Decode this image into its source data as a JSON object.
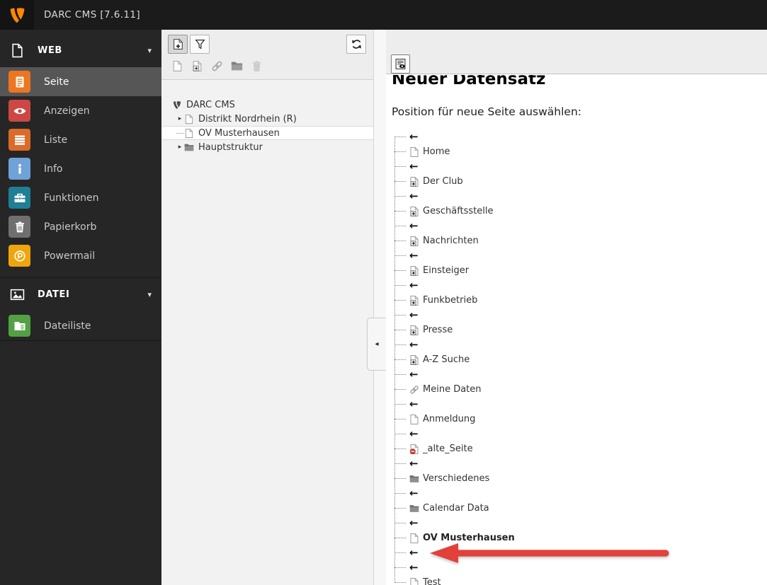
{
  "topbar": {
    "title": "DARC CMS [7.6.11]",
    "logo_icon": "typo3-logo-icon"
  },
  "colors": {
    "typo3_orange": "#ff8700",
    "annotation_arrow": "#e2403a"
  },
  "sidebar": {
    "sections": [
      {
        "label": "WEB",
        "icon": "web-section-icon",
        "chevron_icon": "chevron-down-icon",
        "items": [
          {
            "label": "Seite",
            "icon": "page-module-icon",
            "color": "#ed7621",
            "selected": true
          },
          {
            "label": "Anzeigen",
            "icon": "view-module-icon",
            "color": "#cd4744"
          },
          {
            "label": "Liste",
            "icon": "list-module-icon",
            "color": "#da6b28"
          },
          {
            "label": "Info",
            "icon": "info-module-icon",
            "color": "#6fa2d8"
          },
          {
            "label": "Funktionen",
            "icon": "functions-module-icon",
            "color": "#1e7f95"
          },
          {
            "label": "Papierkorb",
            "icon": "recycler-module-icon",
            "color": "#6f6f6f"
          },
          {
            "label": "Powermail",
            "icon": "powermail-module-icon",
            "color": "#efa50c"
          }
        ]
      },
      {
        "label": "DATEI",
        "icon": "datei-section-icon",
        "chevron_icon": "chevron-down-icon",
        "items": [
          {
            "label": "Dateiliste",
            "icon": "filelist-module-icon",
            "color": "#54a044"
          }
        ]
      }
    ]
  },
  "tree": {
    "nodes": [
      {
        "label": "DARC CMS",
        "icon": "typo3-root-icon",
        "level": 0
      },
      {
        "label": "Distrikt Nordrhein (R)",
        "icon": "page-icon",
        "level": 1,
        "expandable": true
      },
      {
        "label": "OV Musterhausen",
        "icon": "page-icon",
        "level": 1,
        "selected": true,
        "connector": true
      },
      {
        "label": "Hauptstruktur",
        "icon": "folder-icon",
        "level": 1,
        "expandable": true
      }
    ]
  },
  "main": {
    "heading": "Neuer Datensatz",
    "subheading": "Position für neue Seite auswählen:",
    "position_list": [
      {
        "type": "arrow"
      },
      {
        "type": "page",
        "label": "Home",
        "icon": "page-icon"
      },
      {
        "type": "arrow"
      },
      {
        "type": "page",
        "label": "Der Club",
        "icon": "shortcut-page-icon"
      },
      {
        "type": "arrow"
      },
      {
        "type": "page",
        "label": "Geschäftsstelle",
        "icon": "shortcut-page-icon"
      },
      {
        "type": "arrow"
      },
      {
        "type": "page",
        "label": "Nachrichten",
        "icon": "shortcut-page-icon"
      },
      {
        "type": "arrow"
      },
      {
        "type": "page",
        "label": "Einsteiger",
        "icon": "shortcut-page-icon"
      },
      {
        "type": "arrow"
      },
      {
        "type": "page",
        "label": "Funkbetrieb",
        "icon": "shortcut-page-icon"
      },
      {
        "type": "arrow"
      },
      {
        "type": "page",
        "label": "Presse",
        "icon": "shortcut-page-icon"
      },
      {
        "type": "arrow"
      },
      {
        "type": "page",
        "label": "A-Z Suche",
        "icon": "shortcut-page-icon"
      },
      {
        "type": "arrow"
      },
      {
        "type": "page",
        "label": "Meine Daten",
        "icon": "link-icon"
      },
      {
        "type": "arrow"
      },
      {
        "type": "page",
        "label": "Anmeldung",
        "icon": "page-icon"
      },
      {
        "type": "arrow"
      },
      {
        "type": "page",
        "label": "_alte_Seite",
        "icon": "hidden-page-icon"
      },
      {
        "type": "arrow"
      },
      {
        "type": "page",
        "label": "Verschiedenes",
        "icon": "folder-icon"
      },
      {
        "type": "arrow"
      },
      {
        "type": "page",
        "label": "Calendar Data",
        "icon": "folder-icon"
      },
      {
        "type": "arrow"
      },
      {
        "type": "page",
        "label": "OV Musterhausen",
        "icon": "page-icon",
        "bold": true
      },
      {
        "type": "arrow",
        "annotated": true
      },
      {
        "type": "arrow"
      },
      {
        "type": "page",
        "label": "Test",
        "icon": "page-icon"
      }
    ]
  }
}
